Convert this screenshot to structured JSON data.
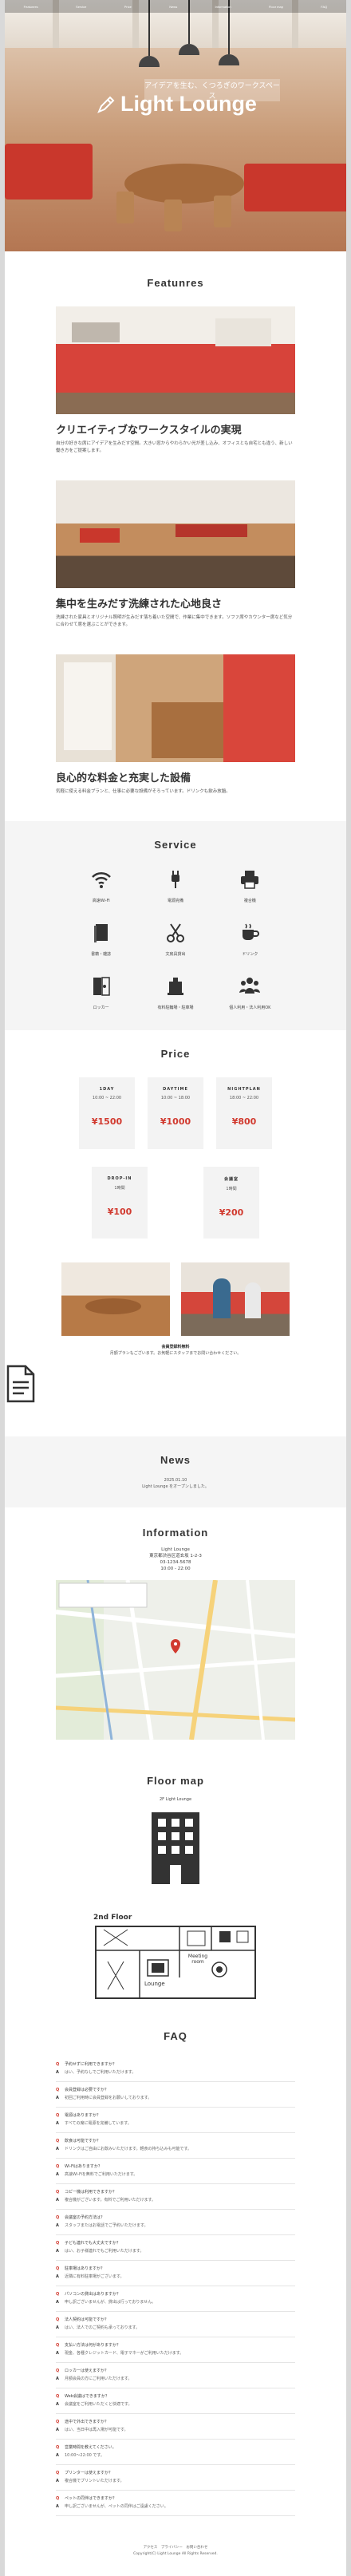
{
  "nav": [
    "Featunres",
    "Service",
    "Price",
    "News",
    "Information",
    "Floor map",
    "FAQ"
  ],
  "hero": {
    "subtitle": "アイデアを生む、くつろぎのワークスペース",
    "brand": "Light Lounge"
  },
  "features": {
    "title": "Featunres",
    "items": [
      {
        "title": "クリエイティブなワークスタイルの実現",
        "text": "自分の好きな席にアイデアを生みだす空間。大きい窓からやわらかい光が差し込み、オフィスとも自宅とも違う、新しい働き方をご提案します。"
      },
      {
        "title": "集中を生みだす洗練された心地良さ",
        "text": "洗練された家具とオリジナル照明が生みだす落ち着いた空間で、作業に集中できます。ソファ席やカウンター席など気分に合わせて席を選ぶことができます。"
      },
      {
        "title": "良心的な料金と充実した設備",
        "text": "気軽に使える料金プランと、仕事に必要な設備がそろっています。ドリンクも飲み放題。"
      }
    ]
  },
  "service": {
    "title": "Service",
    "items": [
      {
        "icon": "wifi-icon",
        "label": "高速Wi-Fi"
      },
      {
        "icon": "plug-icon",
        "label": "電源完備"
      },
      {
        "icon": "printer-icon",
        "label": "複合機"
      },
      {
        "icon": "book-icon",
        "label": "書籍・雑誌"
      },
      {
        "icon": "scissors-icon",
        "label": "文房具貸出"
      },
      {
        "icon": "coffee-icon",
        "label": "ドリンク"
      },
      {
        "icon": "locker-icon",
        "label": "ロッカー"
      },
      {
        "icon": "parking-icon",
        "label": "有料駐輪場・駐車場"
      },
      {
        "icon": "people-icon",
        "label": "個人利用・法人利用OK"
      }
    ]
  },
  "price": {
    "title": "Price",
    "plans": [
      {
        "name": "1DAY",
        "time": "10:00 ~ 22:00",
        "price": "¥1500"
      },
      {
        "name": "DAYTIME",
        "time": "10:00 ~ 18:00",
        "price": "¥1000"
      },
      {
        "name": "NIGHTPLAN",
        "time": "18:00 ~ 22:00",
        "price": "¥800"
      }
    ],
    "drop": [
      {
        "name": "DROP-IN",
        "time": "1時間",
        "price": "¥100"
      },
      {
        "name": "会議室",
        "time": "1時間",
        "price": "¥200"
      }
    ],
    "note_head": "会員登録料無料",
    "note": "月額プランもございます。お気軽にスタッフまでお問い合わせください。"
  },
  "news": {
    "title": "News",
    "date": "2025.01.10",
    "text": "Light Lounge をオープンしました。"
  },
  "info": {
    "title": "Information",
    "name": "Light Lounge",
    "address": "東京都渋谷区道玄坂 1-2-3",
    "tel": "03-1234-5678",
    "hours": "10:00 - 22:00"
  },
  "floor": {
    "title": "Floor map",
    "caption": "2F Light Lounge",
    "label": "2nd Floor",
    "lounge": "Lounge",
    "meeting": "Meeting room"
  },
  "faq": {
    "title": "FAQ",
    "items": [
      {
        "q": "予約せずに利用できますか？",
        "a": "はい、予約なしでご利用いただけます。"
      },
      {
        "q": "会員登録は必要ですか？",
        "a": "初回ご利用時に会員登録をお願いしております。"
      },
      {
        "q": "電源はありますか？",
        "a": "すべての席に電源を完備しています。"
      },
      {
        "q": "飲食は可能ですか？",
        "a": "ドリンクはご自由にお飲みいただけます。軽食の持ち込みも可能です。"
      },
      {
        "q": "Wi-Fiはありますか？",
        "a": "高速Wi-Fiを無料でご利用いただけます。"
      },
      {
        "q": "コピー機は利用できますか？",
        "a": "複合機がございます。有料でご利用いただけます。"
      },
      {
        "q": "会議室の予約方法は？",
        "a": "スタッフまたはお電話でご予約いただけます。"
      },
      {
        "q": "子ども連れでも大丈夫ですか？",
        "a": "はい、お子様連れでもご利用いただけます。"
      },
      {
        "q": "駐車場はありますか？",
        "a": "近隣に有料駐車場がございます。"
      },
      {
        "q": "パソコンの貸出はありますか？",
        "a": "申し訳ございませんが、貸出は行っておりません。"
      },
      {
        "q": "法人契約は可能ですか？",
        "a": "はい、法人でのご契約も承っております。"
      },
      {
        "q": "支払い方法は何がありますか？",
        "a": "現金、各種クレジットカード、電子マネーがご利用いただけます。"
      },
      {
        "q": "ロッカーは使えますか？",
        "a": "月額会員の方にご利用いただけます。"
      },
      {
        "q": "Web会議はできますか？",
        "a": "会議室をご利用いただくと快適です。"
      },
      {
        "q": "途中で外出できますか？",
        "a": "はい、当日中は再入場が可能です。"
      },
      {
        "q": "営業時間を教えてください。",
        "a": "10:00～22:00 です。"
      },
      {
        "q": "プリンターは使えますか？",
        "a": "複合機でプリントいただけます。"
      },
      {
        "q": "ペットの同伴はできますか？",
        "a": "申し訳ございませんが、ペットの同伴はご遠慮ください。"
      }
    ]
  },
  "footer": {
    "links": "アクセス　プライバシー　お問い合わせ",
    "copyright": "Copyright(C) Light Lounge All Rights Reserved."
  }
}
